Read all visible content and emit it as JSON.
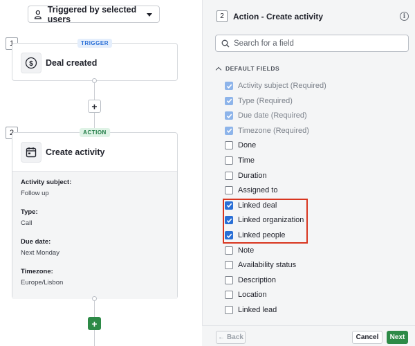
{
  "left": {
    "trigger_dropdown": "Triggered by selected users",
    "step1": {
      "number": "1",
      "badge": "TRIGGER",
      "title": "Deal created",
      "icon": "dollar-icon"
    },
    "step2": {
      "number": "2",
      "badge": "ACTION",
      "title": "Create activity",
      "icon": "calendar-icon",
      "fields": [
        {
          "label": "Activity subject:",
          "value": "Follow up"
        },
        {
          "label": "Type:",
          "value": "Call"
        },
        {
          "label": "Due date:",
          "value": "Next Monday"
        },
        {
          "label": "Timezone:",
          "value": "Europe/Lisbon"
        }
      ]
    },
    "add_step_symbol": "+",
    "add_step_green_symbol": "+"
  },
  "panel": {
    "step_number": "2",
    "title": "Action - Create activity",
    "info_symbol": "i",
    "search_placeholder": "Search for a field",
    "section_label": "DEFAULT FIELDS",
    "fields": [
      {
        "label": "Activity subject (Required)",
        "checked": true,
        "disabled": true
      },
      {
        "label": "Type (Required)",
        "checked": true,
        "disabled": true
      },
      {
        "label": "Due date (Required)",
        "checked": true,
        "disabled": true
      },
      {
        "label": "Timezone (Required)",
        "checked": true,
        "disabled": true
      },
      {
        "label": "Done",
        "checked": false,
        "disabled": false
      },
      {
        "label": "Time",
        "checked": false,
        "disabled": false
      },
      {
        "label": "Duration",
        "checked": false,
        "disabled": false
      },
      {
        "label": "Assigned to",
        "checked": false,
        "disabled": false
      },
      {
        "label": "Linked deal",
        "checked": true,
        "disabled": false
      },
      {
        "label": "Linked organization",
        "checked": true,
        "disabled": false
      },
      {
        "label": "Linked people",
        "checked": true,
        "disabled": false
      },
      {
        "label": "Note",
        "checked": false,
        "disabled": false
      },
      {
        "label": "Availability status",
        "checked": false,
        "disabled": false
      },
      {
        "label": "Description",
        "checked": false,
        "disabled": false
      },
      {
        "label": "Location",
        "checked": false,
        "disabled": false
      },
      {
        "label": "Linked lead",
        "checked": false,
        "disabled": false
      }
    ],
    "footer": {
      "back": "Back",
      "cancel": "Cancel",
      "next": "Next"
    }
  },
  "colors": {
    "accent_blue": "#2a6fd6",
    "green": "#2d8a47",
    "highlight_red": "#d8351f"
  }
}
